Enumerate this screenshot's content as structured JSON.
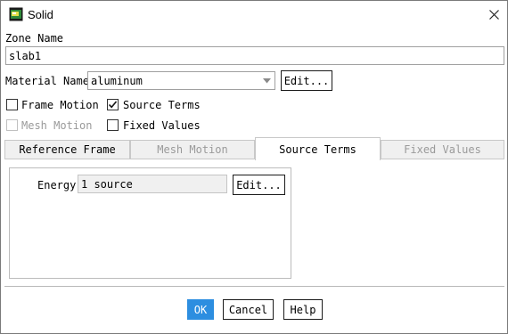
{
  "window": {
    "title": "Solid"
  },
  "zone": {
    "label": "Zone Name",
    "value": "slab1"
  },
  "material": {
    "label": "Material Name",
    "value": "aluminum",
    "edit_label": "Edit..."
  },
  "options": {
    "frame_motion": {
      "label": "Frame Motion",
      "checked": false
    },
    "source_terms": {
      "label": "Source Terms",
      "checked": true
    },
    "mesh_motion": {
      "label": "Mesh Motion",
      "checked": false,
      "enabled": false
    },
    "fixed_values": {
      "label": "Fixed Values",
      "checked": false
    }
  },
  "tabs": [
    {
      "label": "Reference Frame",
      "state": "normal"
    },
    {
      "label": "Mesh Motion",
      "state": "disabled"
    },
    {
      "label": "Source Terms",
      "state": "active"
    },
    {
      "label": "Fixed Values",
      "state": "disabled"
    }
  ],
  "source_panel": {
    "energy_label": "Energy",
    "energy_value": "1 source",
    "edit_label": "Edit..."
  },
  "footer": {
    "ok_label": "OK",
    "cancel_label": "Cancel",
    "help_label": "Help"
  },
  "colors": {
    "ok_button": "#2d8ee0",
    "titlebar_icon": "#3a6e2a"
  }
}
